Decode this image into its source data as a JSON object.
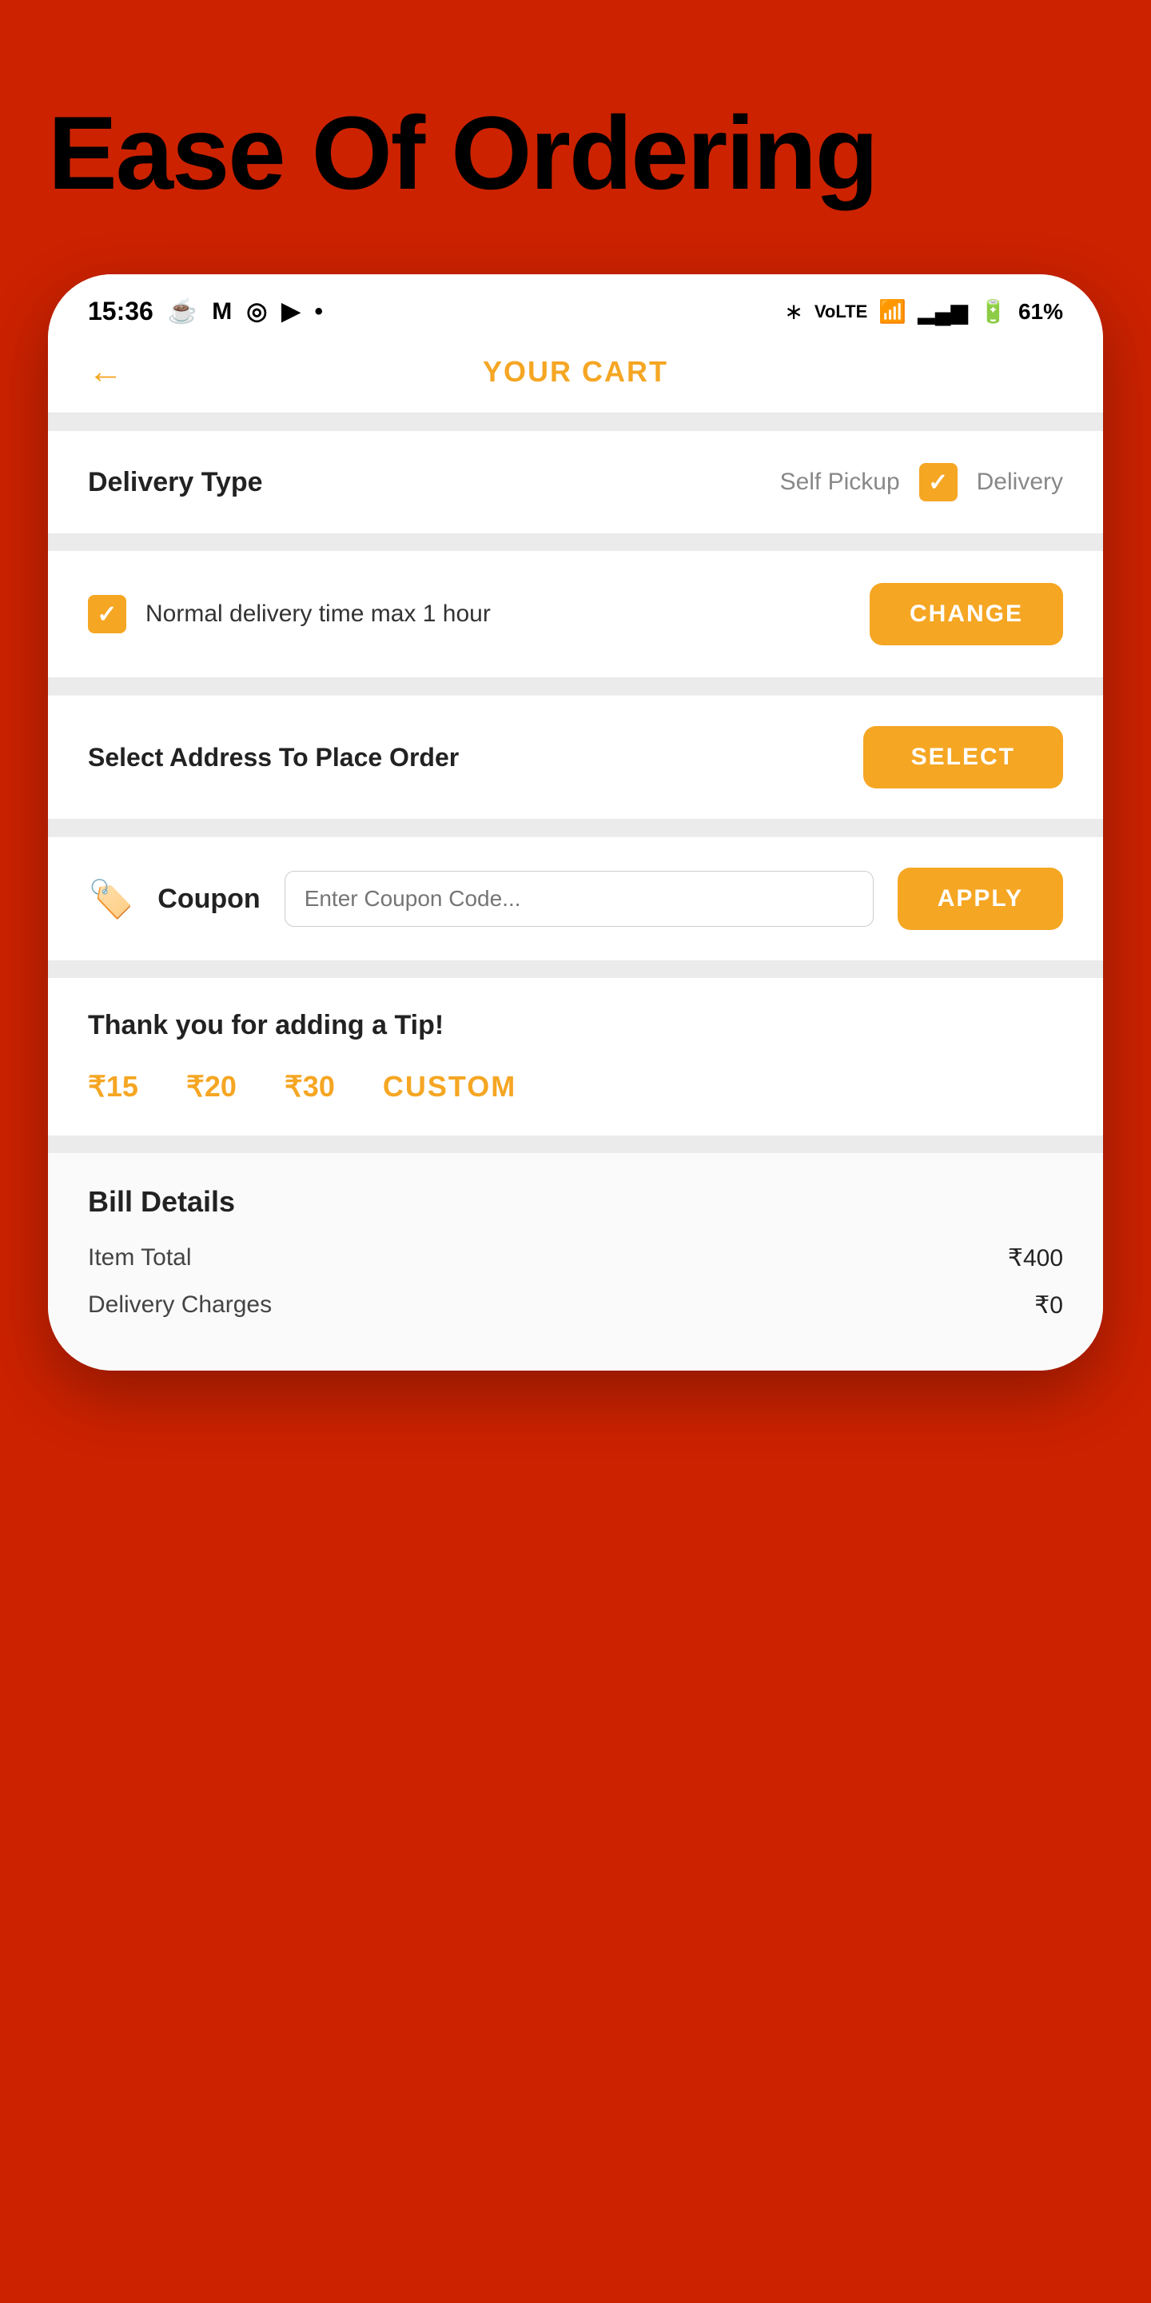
{
  "page": {
    "background_color": "#cc2200",
    "title": "Ease Of Ordering"
  },
  "status_bar": {
    "time": "15:36",
    "battery": "61%",
    "icons": [
      "whatsapp",
      "gmail",
      "moto",
      "youtube",
      "dot",
      "bluetooth",
      "volte",
      "wifi",
      "signal",
      "battery"
    ]
  },
  "header": {
    "title": "YOUR CART",
    "back_label": "←"
  },
  "delivery_type": {
    "label": "Delivery Type",
    "option1": "Self Pickup",
    "option2": "Delivery"
  },
  "delivery_time": {
    "text": "Normal delivery time max 1 hour",
    "button_label": "CHANGE"
  },
  "address": {
    "label": "Select Address To Place Order",
    "button_label": "SELECT"
  },
  "coupon": {
    "label": "Coupon",
    "placeholder": "Enter Coupon Code...",
    "button_label": "APPLY"
  },
  "tip": {
    "title": "Thank you for adding a Tip!",
    "options": [
      "₹15",
      "₹20",
      "₹30"
    ],
    "custom_label": "CUSTOM"
  },
  "bill": {
    "title": "Bill Details",
    "rows": [
      {
        "label": "Item Total",
        "value": "₹400"
      },
      {
        "label": "Delivery Charges",
        "value": "₹0"
      }
    ]
  }
}
